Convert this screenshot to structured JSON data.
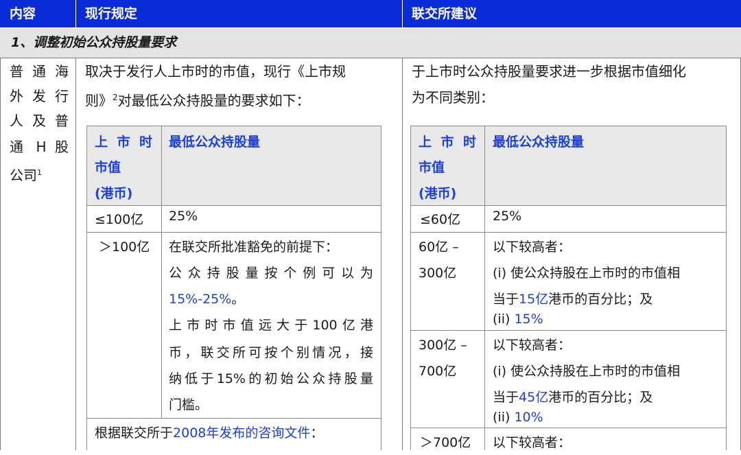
{
  "header": {
    "col1": "内容",
    "col2": "现行规定",
    "col3": "联交所建议"
  },
  "section": {
    "title": "1、调整初始公众持股量要求"
  },
  "left_label": {
    "lines": [
      "普 通 海",
      "外 发 行",
      "人 及 普",
      "通 H 股",
      "公司"
    ],
    "footnote": "1"
  },
  "current": {
    "intro_line1": "取决于发行人上市时的市值，现行《上市规",
    "intro_line2_a": "则》",
    "intro_line2_sup": "2",
    "intro_line2_b": "对最低公众持股量的要求如下：",
    "table_head": {
      "cap_lines": [
        "上 市 时",
        "市值",
        "(港币)"
      ],
      "min": "最低公众持股量"
    },
    "rows": [
      {
        "cap": "≤100亿",
        "min": "25%"
      },
      {
        "cap": "＞100亿",
        "min_l1": "在联交所批准豁免的前提下：",
        "min_l2": "公众持股量按个例可以为",
        "min_l3": "15%-25%",
        "min_l3_end": "。",
        "min_l4": "上市时市值远大于100亿港",
        "min_l5": "币，联交所可按个别情况，接",
        "min_l6": "纳低于15%的初始公众持股量",
        "min_l7": "门槛。"
      }
    ],
    "footer_a": "根据联交所于",
    "footer_link": "2008年发布的咨询文件",
    "footer_b": "："
  },
  "proposed": {
    "intro_line1": "于上市时公众持股量要求进一步根据市值细化",
    "intro_line2": "为不同类别：",
    "table_head": {
      "cap_lines": [
        "上 市 时",
        "市值",
        "(港币)"
      ],
      "min": "最低公众持股量"
    },
    "rows": [
      {
        "cap": "≤60亿",
        "min": "25%"
      },
      {
        "cap_l1": "60亿 –",
        "cap_l2": "300亿",
        "l1": "以下较高者：",
        "l2": "(i) 使公众持股在上市时的市值相",
        "l3_a": "当于",
        "l3_blue": "15亿",
        "l3_b": "港币的百分比；及",
        "l4_a": "(ii) ",
        "l4_blue": "15%"
      },
      {
        "cap_l1": "300亿 –",
        "cap_l2": "700亿",
        "l1": "以下较高者：",
        "l2": "(i) 使公众持股在上市时的市值相",
        "l3_a": "当于",
        "l3_blue": "45亿",
        "l3_b": "港币的百分比；及",
        "l4_a": "(ii) ",
        "l4_blue": "10%"
      },
      {
        "cap": "＞700亿",
        "l1": "以下较高者："
      }
    ]
  }
}
